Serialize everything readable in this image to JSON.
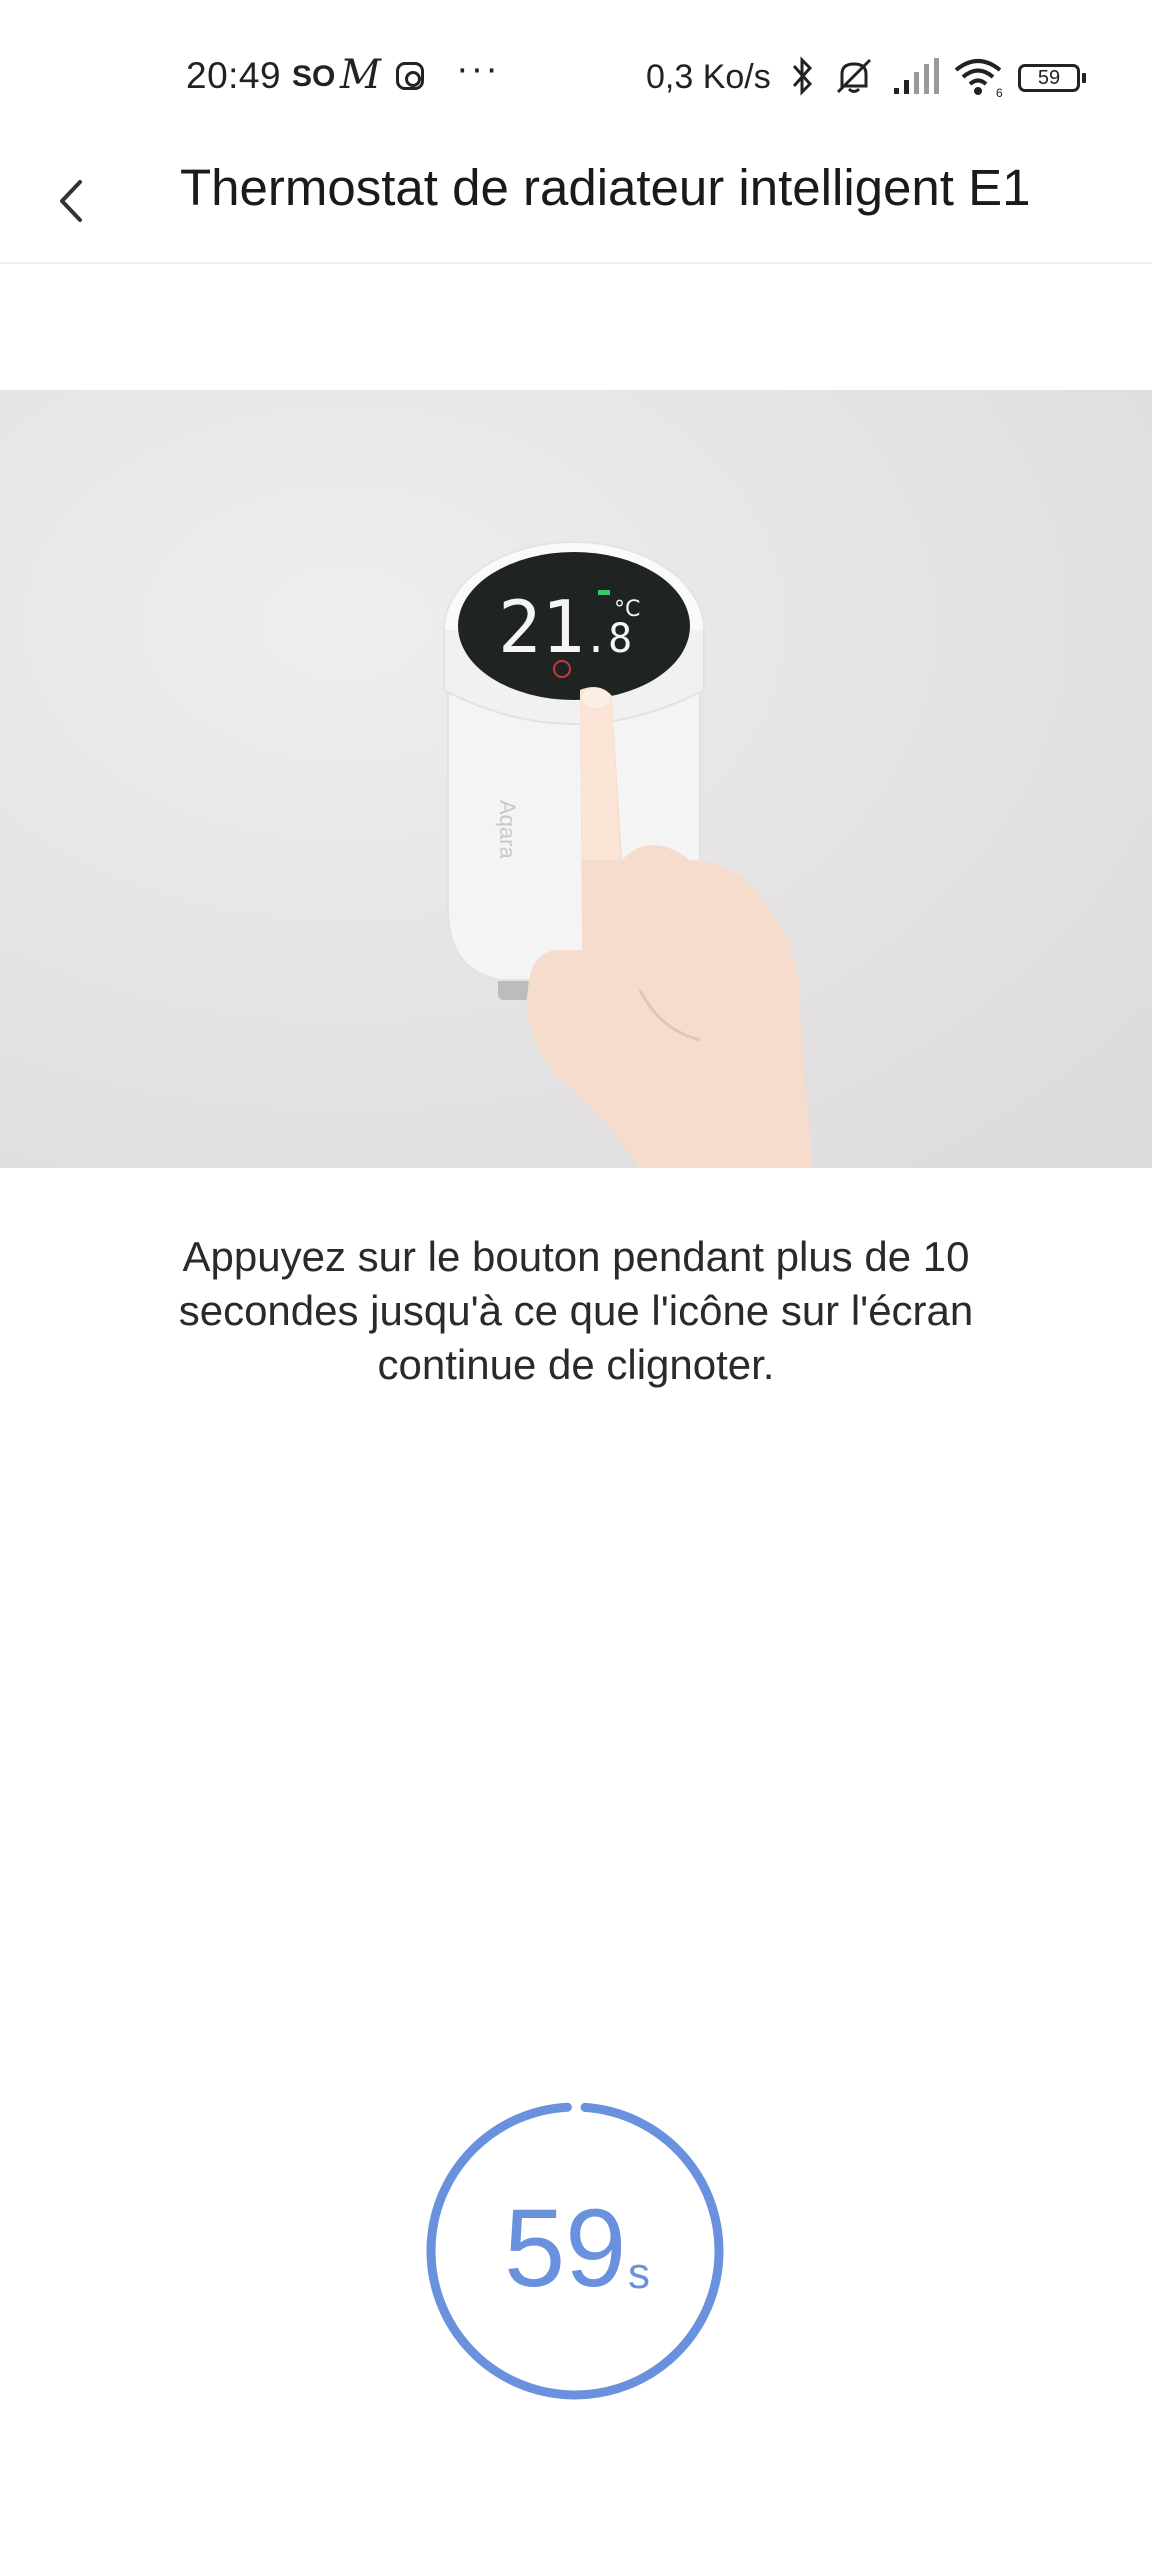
{
  "status_bar": {
    "time": "20:49",
    "carrier": "SO",
    "m_icon_letter": "M",
    "more": "···",
    "net_speed": "0,3 Ko/s",
    "battery": "59",
    "icons": [
      "instagram-icon",
      "bluetooth-icon",
      "mute-icon",
      "signal-icon",
      "wifi-icon",
      "battery-icon"
    ]
  },
  "header": {
    "title": "Thermostat de radiateur intelligent E1",
    "back_icon": "chevron-left-icon"
  },
  "illustration": {
    "display_digits": "21",
    "display_decimal": ".8",
    "display_unit": "°C",
    "brand_text": "Aqara"
  },
  "instruction": "Appuyez sur le bouton pendant plus de 10 secondes jusqu'à ce que l'icône sur l'écran continue de clignoter.",
  "countdown": {
    "value": "59",
    "unit": "s",
    "progress_fraction": 0.98,
    "color": "#6a91de"
  }
}
